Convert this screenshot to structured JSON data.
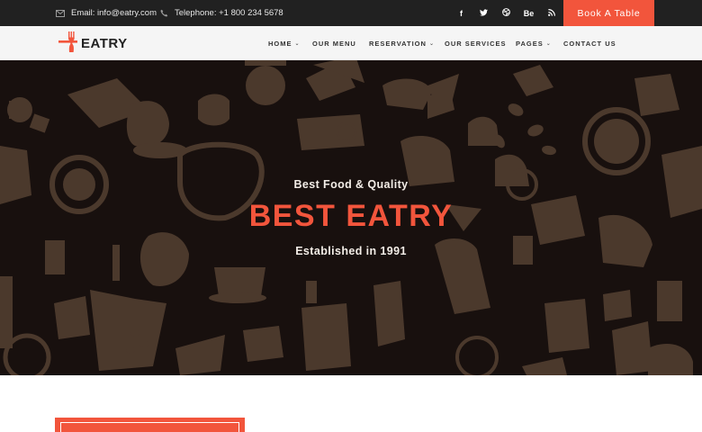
{
  "topbar": {
    "email_icon": "envelope-icon",
    "email_text": "Email: info@eatry.com",
    "phone_icon": "phone-icon",
    "phone_text": "Telephone: +1 800 234 5678",
    "socials": [
      {
        "icon": "facebook-icon",
        "glyph": "f"
      },
      {
        "icon": "twitter-icon",
        "glyph": ""
      },
      {
        "icon": "dribbble-icon",
        "glyph": ""
      },
      {
        "icon": "behance-icon",
        "glyph": "Be"
      },
      {
        "icon": "rss-icon",
        "glyph": ""
      }
    ],
    "book_label": "Book A Table"
  },
  "header": {
    "logo_text": "EATRY",
    "logo_icon": "fork-knife-icon",
    "nav": [
      {
        "label": "HOME",
        "dropdown": true
      },
      {
        "label": "OUR MENU",
        "dropdown": false
      },
      {
        "label": "RESERVATION",
        "dropdown": true
      },
      {
        "label": "OUR SERVICES",
        "dropdown": false
      },
      {
        "label": "PAGES",
        "dropdown": true
      },
      {
        "label": "CONTACT US",
        "dropdown": false
      }
    ]
  },
  "hero": {
    "subtitle": "Best Food & Quality",
    "title": "BEST EATRY",
    "established": "Established in 1991"
  },
  "colors": {
    "accent": "#f2553c",
    "topbar_bg": "#212121",
    "nav_bg": "#f5f5f5",
    "hero_bg": "#1a1210",
    "pattern": "#6b5240"
  }
}
